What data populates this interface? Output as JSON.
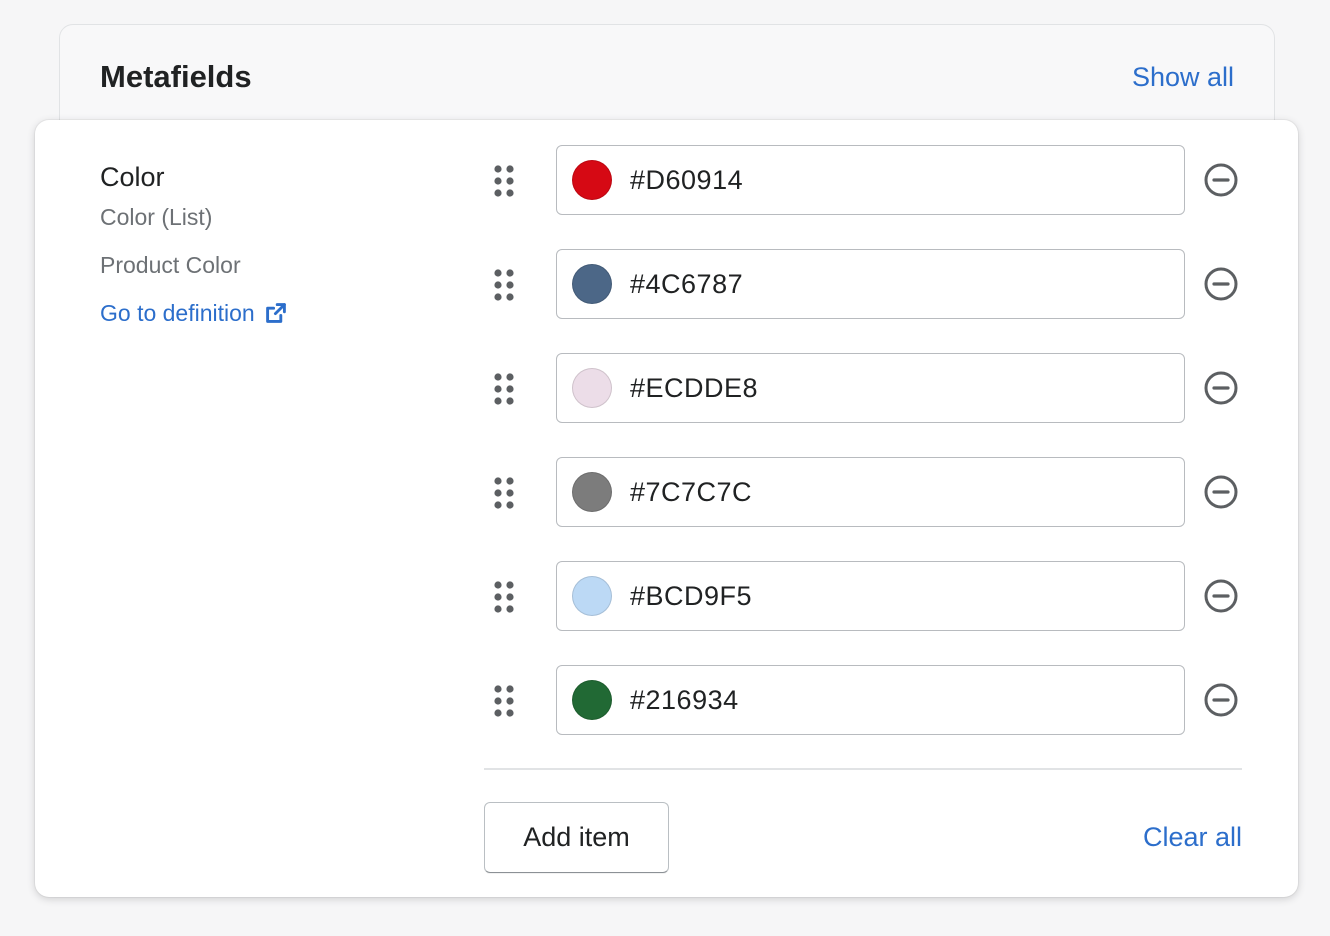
{
  "card": {
    "title": "Metafields",
    "show_all_label": "Show all"
  },
  "field": {
    "name": "Color",
    "type": "Color (List)",
    "description": "Product Color",
    "definition_link": "Go to definition"
  },
  "items": [
    {
      "value": "#D60914",
      "swatch": "#D60914"
    },
    {
      "value": "#4C6787",
      "swatch": "#4C6787"
    },
    {
      "value": "#ECDDE8",
      "swatch": "#ECDDE8"
    },
    {
      "value": "#7C7C7C",
      "swatch": "#7C7C7C"
    },
    {
      "value": "#BCD9F5",
      "swatch": "#BCD9F5"
    },
    {
      "value": "#216934",
      "swatch": "#216934"
    }
  ],
  "actions": {
    "add_item_label": "Add item",
    "clear_all_label": "Clear all"
  },
  "colors": {
    "link": "#2c6ecb",
    "text": "#202223",
    "subdued_text": "#6d7175",
    "icon": "#5c5f62"
  },
  "icons": {
    "drag_handle": "drag-handle-icon",
    "remove": "minus-circle-icon",
    "external_link": "external-link-icon"
  }
}
